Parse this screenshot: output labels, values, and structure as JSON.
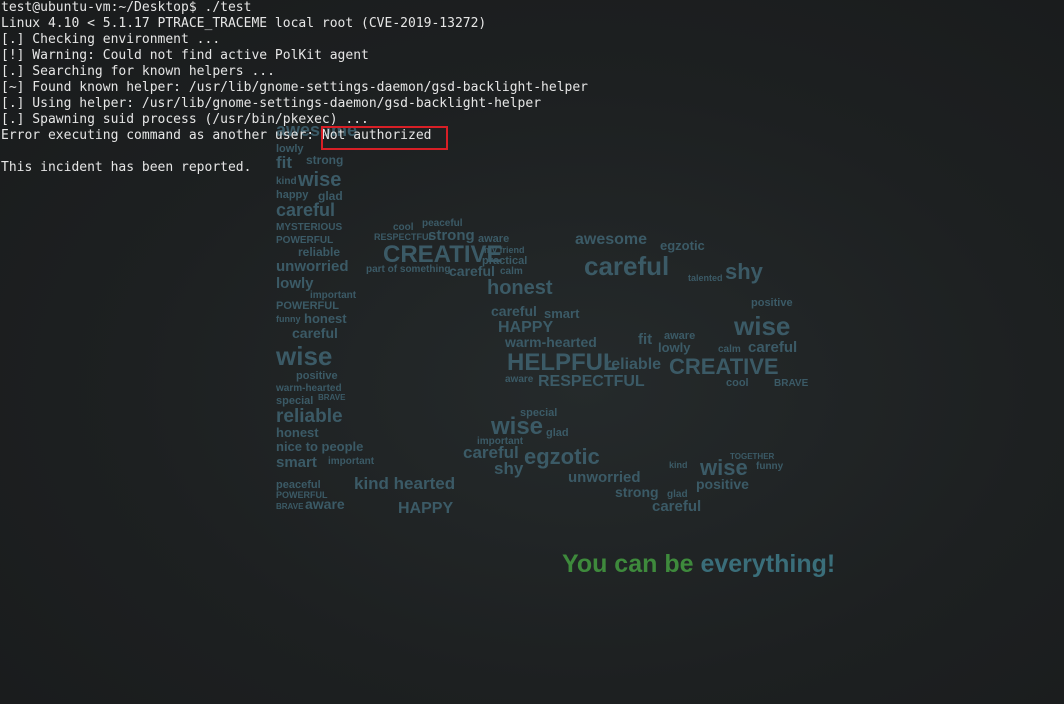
{
  "terminal": {
    "lines": [
      "test@ubuntu-vm:~/Desktop$ ./test",
      "Linux 4.10 < 5.1.17 PTRACE_TRACEME local root (CVE-2019-13272)",
      "[.] Checking environment ...",
      "[!] Warning: Could not find active PolKit agent",
      "[.] Searching for known helpers ...",
      "[~] Found known helper: /usr/lib/gnome-settings-daemon/gsd-backlight-helper",
      "[.] Using helper: /usr/lib/gnome-settings-daemon/gsd-backlight-helper",
      "[.] Spawning suid process (/usr/bin/pkexec) ...",
      "Error executing command as another user: Not authorized",
      "",
      "This incident has been reported."
    ],
    "highlighted_text": "Not authorized",
    "highlight_color": "#d81f26",
    "text_color": "#e6e6e6",
    "background_color": "#1c1e1f"
  },
  "wallpaper": {
    "slogan": "You can be everything!",
    "slogan_colors": [
      "#3e8a3c",
      "#3a6e7a"
    ],
    "word_colors": [
      "#3b5a66",
      "#4a6b76",
      "#2f4a54"
    ],
    "words": [
      "awesome",
      "positive",
      "lowly",
      "fit",
      "strong",
      "happy",
      "kind",
      "wise",
      "glad",
      "careful",
      "MYSTERIOUS",
      "POWERFUL",
      "reliable",
      "unworried",
      "lowly",
      "important",
      "POWERFUL",
      "funny",
      "honest",
      "careful",
      "wise",
      "positive",
      "warm-hearted",
      "special",
      "BRAVE",
      "reliable",
      "honest",
      "nice to people",
      "smart",
      "important",
      "peaceful",
      "POWERFUL",
      "BRAVE",
      "aware",
      "cool",
      "peaceful",
      "RESPECTFUL",
      "strong",
      "aware",
      "CREATIVE",
      "my friend",
      "practical",
      "part of something",
      "careful",
      "calm",
      "honest",
      "careful",
      "smart",
      "HAPPY",
      "warm-hearted",
      "HELPFUL",
      "reliable",
      "RESPECTFUL",
      "aware",
      "special",
      "wise",
      "glad",
      "important",
      "careful",
      "egzotic",
      "shy",
      "unworried",
      "kind hearted",
      "HAPPY",
      "strong",
      "awesome",
      "egzotic",
      "careful",
      "shy",
      "wise",
      "careful",
      "lowly",
      "CREATIVE",
      "cool",
      "BRAVE",
      "positive",
      "talented",
      "wise",
      "kind",
      "glad",
      "funny",
      "TOGETHER",
      "calm",
      "fit",
      "aware"
    ]
  }
}
